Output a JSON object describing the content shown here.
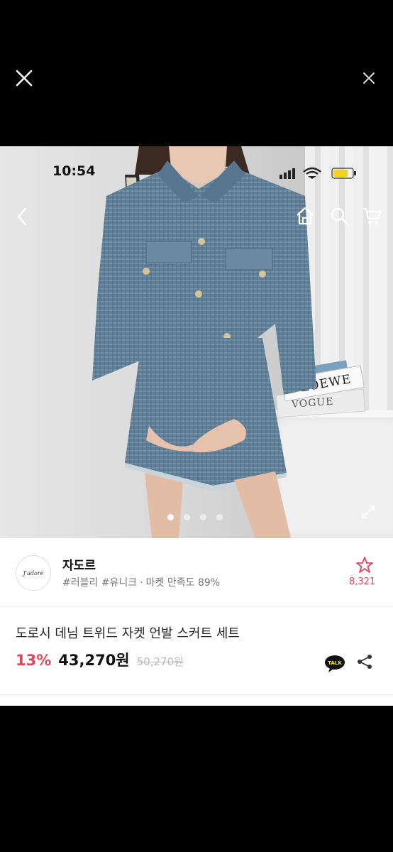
{
  "status_bar": {
    "time": "10:54"
  },
  "shop": {
    "logo_text": "J'adore",
    "name": "자도르",
    "tags": "#러블리 #유니크",
    "satisfaction": "마켓 만족도 89%",
    "favorite_count": "8,321"
  },
  "product": {
    "title": "도로시 데님 트위드 자켓 언발 스커트 세트",
    "discount": "13%",
    "price": "43,270원",
    "original_price": "50,270원"
  },
  "photo": {
    "book_top": "LOEWE",
    "book_bottom": "VOGUE",
    "carousel": {
      "count": 4,
      "active": 0
    }
  },
  "icons": {
    "viewer_close_left": "close-icon",
    "viewer_close_right": "close-icon",
    "back": "chevron-left-icon",
    "home": "home-icon",
    "search": "search-icon",
    "cart": "cart-icon",
    "favorite": "star-outline-icon",
    "kakao": "kakao-talk-icon",
    "share": "share-icon",
    "expand": "expand-icon"
  },
  "colors": {
    "accent": "#e5465f",
    "background": "#000000"
  }
}
